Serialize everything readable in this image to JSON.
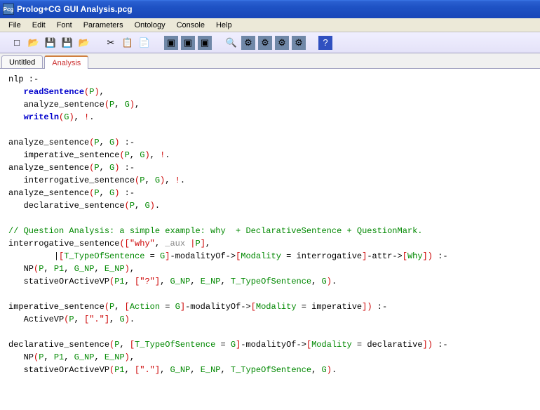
{
  "window": {
    "title": "Prolog+CG GUI Analysis.pcg",
    "icon_text": "Pcg"
  },
  "menu": {
    "items": [
      "File",
      "Edit",
      "Font",
      "Parameters",
      "Ontology",
      "Console",
      "Help"
    ]
  },
  "toolbar": {
    "buttons": [
      {
        "name": "new",
        "glyph": "□",
        "color": "#f0f0d0"
      },
      {
        "name": "open",
        "glyph": "📂"
      },
      {
        "name": "save",
        "glyph": "💾"
      },
      {
        "name": "save-all",
        "glyph": "💾"
      },
      {
        "name": "open2",
        "glyph": "📂"
      },
      {
        "name": "sep"
      },
      {
        "name": "cut",
        "glyph": "✂"
      },
      {
        "name": "copy",
        "glyph": "📋"
      },
      {
        "name": "paste",
        "glyph": "📄"
      },
      {
        "name": "sep"
      },
      {
        "name": "run1",
        "glyph": "▣",
        "bg": "#7088a8"
      },
      {
        "name": "run2",
        "glyph": "▣",
        "bg": "#7088a8"
      },
      {
        "name": "run3",
        "glyph": "▣",
        "bg": "#7088a8"
      },
      {
        "name": "sep"
      },
      {
        "name": "find",
        "glyph": "🔍"
      },
      {
        "name": "tool1",
        "glyph": "⚙",
        "bg": "#7088a8"
      },
      {
        "name": "tool2",
        "glyph": "⚙",
        "bg": "#7088a8"
      },
      {
        "name": "tool3",
        "glyph": "⚙",
        "bg": "#7088a8"
      },
      {
        "name": "tool4",
        "glyph": "⚙",
        "bg": "#7088a8"
      },
      {
        "name": "sep"
      },
      {
        "name": "help",
        "glyph": "?",
        "bg": "#3050c0",
        "fg": "#fff"
      }
    ]
  },
  "tabs": {
    "items": [
      {
        "label": "Untitled",
        "active": false
      },
      {
        "label": "Analysis",
        "active": true
      }
    ]
  },
  "code": {
    "lines": [
      [
        {
          "t": "nlp :-",
          "c": "blk"
        }
      ],
      [
        {
          "t": "   ",
          "c": "blk"
        },
        {
          "t": "readSentence",
          "c": "kw"
        },
        {
          "t": "(",
          "c": "red"
        },
        {
          "t": "P",
          "c": "grn"
        },
        {
          "t": ")",
          "c": "red"
        },
        {
          "t": ",",
          "c": "blk"
        }
      ],
      [
        {
          "t": "   analyze_sentence",
          "c": "blk"
        },
        {
          "t": "(",
          "c": "red"
        },
        {
          "t": "P",
          "c": "grn"
        },
        {
          "t": ", ",
          "c": "blk"
        },
        {
          "t": "G",
          "c": "grn"
        },
        {
          "t": ")",
          "c": "red"
        },
        {
          "t": ",",
          "c": "blk"
        }
      ],
      [
        {
          "t": "   ",
          "c": "blk"
        },
        {
          "t": "writeln",
          "c": "kw"
        },
        {
          "t": "(",
          "c": "red"
        },
        {
          "t": "G",
          "c": "grn"
        },
        {
          "t": ")",
          "c": "red"
        },
        {
          "t": ", ",
          "c": "blk"
        },
        {
          "t": "!",
          "c": "red"
        },
        {
          "t": ".",
          "c": "blk"
        }
      ],
      [
        {
          "t": "",
          "c": "blk"
        }
      ],
      [
        {
          "t": "analyze_sentence",
          "c": "blk"
        },
        {
          "t": "(",
          "c": "red"
        },
        {
          "t": "P",
          "c": "grn"
        },
        {
          "t": ", ",
          "c": "blk"
        },
        {
          "t": "G",
          "c": "grn"
        },
        {
          "t": ")",
          "c": "red"
        },
        {
          "t": " :-",
          "c": "blk"
        }
      ],
      [
        {
          "t": "   imperative_sentence",
          "c": "blk"
        },
        {
          "t": "(",
          "c": "red"
        },
        {
          "t": "P",
          "c": "grn"
        },
        {
          "t": ", ",
          "c": "blk"
        },
        {
          "t": "G",
          "c": "grn"
        },
        {
          "t": ")",
          "c": "red"
        },
        {
          "t": ", ",
          "c": "blk"
        },
        {
          "t": "!",
          "c": "red"
        },
        {
          "t": ".",
          "c": "blk"
        }
      ],
      [
        {
          "t": "analyze_sentence",
          "c": "blk"
        },
        {
          "t": "(",
          "c": "red"
        },
        {
          "t": "P",
          "c": "grn"
        },
        {
          "t": ", ",
          "c": "blk"
        },
        {
          "t": "G",
          "c": "grn"
        },
        {
          "t": ")",
          "c": "red"
        },
        {
          "t": " :-",
          "c": "blk"
        }
      ],
      [
        {
          "t": "   interrogative_sentence",
          "c": "blk"
        },
        {
          "t": "(",
          "c": "red"
        },
        {
          "t": "P",
          "c": "grn"
        },
        {
          "t": ", ",
          "c": "blk"
        },
        {
          "t": "G",
          "c": "grn"
        },
        {
          "t": ")",
          "c": "red"
        },
        {
          "t": ", ",
          "c": "blk"
        },
        {
          "t": "!",
          "c": "red"
        },
        {
          "t": ".",
          "c": "blk"
        }
      ],
      [
        {
          "t": "analyze_sentence",
          "c": "blk"
        },
        {
          "t": "(",
          "c": "red"
        },
        {
          "t": "P",
          "c": "grn"
        },
        {
          "t": ", ",
          "c": "blk"
        },
        {
          "t": "G",
          "c": "grn"
        },
        {
          "t": ")",
          "c": "red"
        },
        {
          "t": " :-",
          "c": "blk"
        }
      ],
      [
        {
          "t": "   declarative_sentence",
          "c": "blk"
        },
        {
          "t": "(",
          "c": "red"
        },
        {
          "t": "P",
          "c": "grn"
        },
        {
          "t": ", ",
          "c": "blk"
        },
        {
          "t": "G",
          "c": "grn"
        },
        {
          "t": ")",
          "c": "red"
        },
        {
          "t": ".",
          "c": "blk"
        }
      ],
      [
        {
          "t": "",
          "c": "blk"
        }
      ],
      [
        {
          "t": "// Question Analysis: a simple example: why  + DeclarativeSentence + QuestionMark.",
          "c": "grn"
        }
      ],
      [
        {
          "t": "interrogative_sentence",
          "c": "blk"
        },
        {
          "t": "([",
          "c": "red"
        },
        {
          "t": "\"why\"",
          "c": "str"
        },
        {
          "t": ", ",
          "c": "blk"
        },
        {
          "t": "_aux ",
          "c": "gry"
        },
        {
          "t": "|",
          "c": "red"
        },
        {
          "t": "P",
          "c": "grn"
        },
        {
          "t": "]",
          "c": "red"
        },
        {
          "t": ",",
          "c": "blk"
        }
      ],
      [
        {
          "t": "         ",
          "c": "blk"
        },
        {
          "t": "|",
          "c": "blk"
        },
        {
          "t": "[",
          "c": "red"
        },
        {
          "t": "T_TypeOfSentence",
          "c": "grn"
        },
        {
          "t": " = ",
          "c": "blk"
        },
        {
          "t": "G",
          "c": "grn"
        },
        {
          "t": "]",
          "c": "red"
        },
        {
          "t": "-modalityOf->",
          "c": "blk"
        },
        {
          "t": "[",
          "c": "red"
        },
        {
          "t": "Modality",
          "c": "grn"
        },
        {
          "t": " = interrogative",
          "c": "blk"
        },
        {
          "t": "]",
          "c": "red"
        },
        {
          "t": "-attr->",
          "c": "blk"
        },
        {
          "t": "[",
          "c": "red"
        },
        {
          "t": "Why",
          "c": "grn"
        },
        {
          "t": "])",
          "c": "red"
        },
        {
          "t": " :-",
          "c": "blk"
        }
      ],
      [
        {
          "t": "   NP",
          "c": "blk"
        },
        {
          "t": "(",
          "c": "red"
        },
        {
          "t": "P",
          "c": "grn"
        },
        {
          "t": ", ",
          "c": "blk"
        },
        {
          "t": "P1",
          "c": "grn"
        },
        {
          "t": ", ",
          "c": "blk"
        },
        {
          "t": "G_NP",
          "c": "grn"
        },
        {
          "t": ", ",
          "c": "blk"
        },
        {
          "t": "E_NP",
          "c": "grn"
        },
        {
          "t": ")",
          "c": "red"
        },
        {
          "t": ",",
          "c": "blk"
        }
      ],
      [
        {
          "t": "   stativeOrActiveVP",
          "c": "blk"
        },
        {
          "t": "(",
          "c": "red"
        },
        {
          "t": "P1",
          "c": "grn"
        },
        {
          "t": ", ",
          "c": "blk"
        },
        {
          "t": "[",
          "c": "red"
        },
        {
          "t": "\"?\"",
          "c": "str"
        },
        {
          "t": "]",
          "c": "red"
        },
        {
          "t": ", ",
          "c": "blk"
        },
        {
          "t": "G_NP",
          "c": "grn"
        },
        {
          "t": ", ",
          "c": "blk"
        },
        {
          "t": "E_NP",
          "c": "grn"
        },
        {
          "t": ", ",
          "c": "blk"
        },
        {
          "t": "T_TypeOfSentence",
          "c": "grn"
        },
        {
          "t": ", ",
          "c": "blk"
        },
        {
          "t": "G",
          "c": "grn"
        },
        {
          "t": ")",
          "c": "red"
        },
        {
          "t": ".",
          "c": "blk"
        }
      ],
      [
        {
          "t": "",
          "c": "blk"
        }
      ],
      [
        {
          "t": "imperative_sentence",
          "c": "blk"
        },
        {
          "t": "(",
          "c": "red"
        },
        {
          "t": "P",
          "c": "grn"
        },
        {
          "t": ", ",
          "c": "blk"
        },
        {
          "t": "[",
          "c": "red"
        },
        {
          "t": "Action",
          "c": "grn"
        },
        {
          "t": " = ",
          "c": "blk"
        },
        {
          "t": "G",
          "c": "grn"
        },
        {
          "t": "]",
          "c": "red"
        },
        {
          "t": "-modalityOf->",
          "c": "blk"
        },
        {
          "t": "[",
          "c": "red"
        },
        {
          "t": "Modality",
          "c": "grn"
        },
        {
          "t": " = imperative",
          "c": "blk"
        },
        {
          "t": "])",
          "c": "red"
        },
        {
          "t": " :-",
          "c": "blk"
        }
      ],
      [
        {
          "t": "   ActiveVP",
          "c": "blk"
        },
        {
          "t": "(",
          "c": "red"
        },
        {
          "t": "P",
          "c": "grn"
        },
        {
          "t": ", ",
          "c": "blk"
        },
        {
          "t": "[",
          "c": "red"
        },
        {
          "t": "\".\"",
          "c": "str"
        },
        {
          "t": "]",
          "c": "red"
        },
        {
          "t": ", ",
          "c": "blk"
        },
        {
          "t": "G",
          "c": "grn"
        },
        {
          "t": ")",
          "c": "red"
        },
        {
          "t": ".",
          "c": "blk"
        }
      ],
      [
        {
          "t": "",
          "c": "blk"
        }
      ],
      [
        {
          "t": "declarative_sentence",
          "c": "blk"
        },
        {
          "t": "(",
          "c": "red"
        },
        {
          "t": "P",
          "c": "grn"
        },
        {
          "t": ", ",
          "c": "blk"
        },
        {
          "t": "[",
          "c": "red"
        },
        {
          "t": "T_TypeOfSentence",
          "c": "grn"
        },
        {
          "t": " = ",
          "c": "blk"
        },
        {
          "t": "G",
          "c": "grn"
        },
        {
          "t": "]",
          "c": "red"
        },
        {
          "t": "-modalityOf->",
          "c": "blk"
        },
        {
          "t": "[",
          "c": "red"
        },
        {
          "t": "Modality",
          "c": "grn"
        },
        {
          "t": " = declarative",
          "c": "blk"
        },
        {
          "t": "])",
          "c": "red"
        },
        {
          "t": " :-",
          "c": "blk"
        }
      ],
      [
        {
          "t": "   NP",
          "c": "blk"
        },
        {
          "t": "(",
          "c": "red"
        },
        {
          "t": "P",
          "c": "grn"
        },
        {
          "t": ", ",
          "c": "blk"
        },
        {
          "t": "P1",
          "c": "grn"
        },
        {
          "t": ", ",
          "c": "blk"
        },
        {
          "t": "G_NP",
          "c": "grn"
        },
        {
          "t": ", ",
          "c": "blk"
        },
        {
          "t": "E_NP",
          "c": "grn"
        },
        {
          "t": ")",
          "c": "red"
        },
        {
          "t": ",",
          "c": "blk"
        }
      ],
      [
        {
          "t": "   stativeOrActiveVP",
          "c": "blk"
        },
        {
          "t": "(",
          "c": "red"
        },
        {
          "t": "P1",
          "c": "grn"
        },
        {
          "t": ", ",
          "c": "blk"
        },
        {
          "t": "[",
          "c": "red"
        },
        {
          "t": "\".\"",
          "c": "str"
        },
        {
          "t": "]",
          "c": "red"
        },
        {
          "t": ", ",
          "c": "blk"
        },
        {
          "t": "G_NP",
          "c": "grn"
        },
        {
          "t": ", ",
          "c": "blk"
        },
        {
          "t": "E_NP",
          "c": "grn"
        },
        {
          "t": ", ",
          "c": "blk"
        },
        {
          "t": "T_TypeOfSentence",
          "c": "grn"
        },
        {
          "t": ", ",
          "c": "blk"
        },
        {
          "t": "G",
          "c": "grn"
        },
        {
          "t": ")",
          "c": "red"
        },
        {
          "t": ".",
          "c": "blk"
        }
      ]
    ]
  }
}
